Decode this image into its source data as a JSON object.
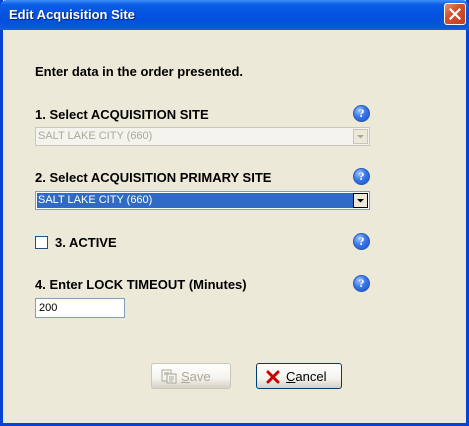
{
  "window": {
    "title": "Edit Acquisition Site"
  },
  "instructions": "Enter data in the order presented.",
  "fields": {
    "acquisition_site": {
      "label": "1. Select ACQUISITION SITE",
      "value": "SALT LAKE CITY (660)",
      "help": "?"
    },
    "primary_site": {
      "label": "2. Select ACQUISITION PRIMARY SITE",
      "value": "SALT LAKE CITY (660)",
      "help": "?"
    },
    "active": {
      "label": "3. ACTIVE",
      "checked": false,
      "help": "?"
    },
    "lock_timeout": {
      "label": "4. Enter LOCK TIMEOUT (Minutes)",
      "value": "200",
      "help": "?"
    }
  },
  "buttons": {
    "save": {
      "mnemonic": "S",
      "rest": "ave"
    },
    "cancel": {
      "mnemonic": "C",
      "rest": "ancel"
    }
  },
  "colors": {
    "titlebar": "#0453e0",
    "dialog_bg": "#ece9d8",
    "selection": "#316ac5",
    "close_button": "#c1401d",
    "help_icon": "#3a78e8",
    "cancel_icon": "#cc0000"
  }
}
